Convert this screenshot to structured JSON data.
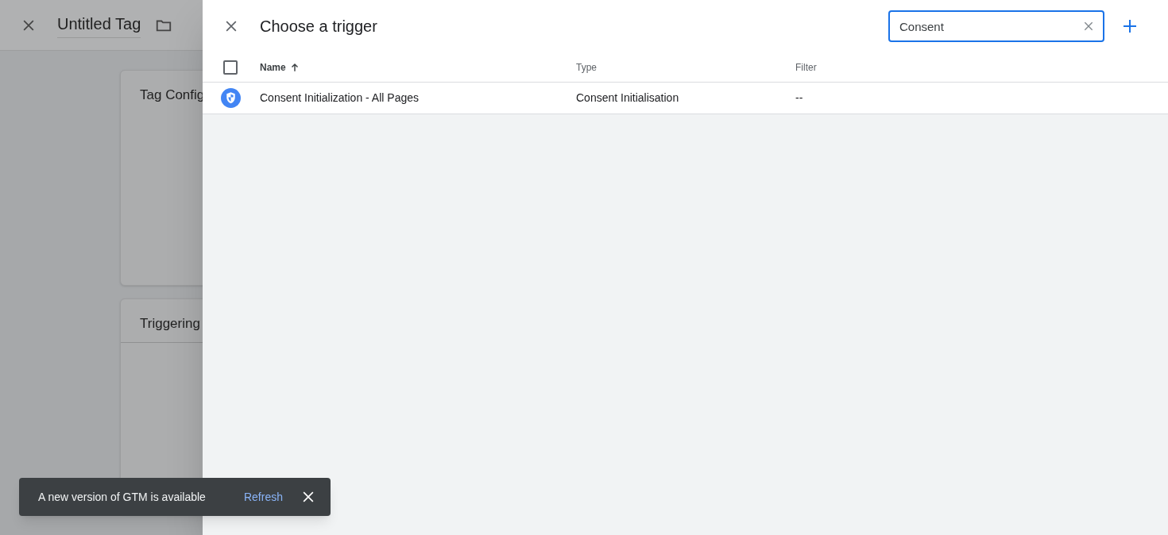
{
  "background_page": {
    "title": "Untitled Tag",
    "cards": [
      {
        "title": "Tag Config"
      },
      {
        "title": "Triggering"
      }
    ]
  },
  "panel": {
    "title": "Choose a trigger",
    "search": {
      "value": "Consent"
    },
    "table": {
      "columns": [
        {
          "label": "Name",
          "sorted": true
        },
        {
          "label": "Type",
          "sorted": false
        },
        {
          "label": "Filter",
          "sorted": false
        }
      ],
      "select_all": {
        "checked": false
      },
      "rows": [
        {
          "name": "Consent Initialization - All Pages",
          "type": "Consent Initialisation",
          "filter": "--"
        }
      ]
    }
  },
  "snackbar": {
    "message": "A new version of GTM is available",
    "action": "Refresh"
  }
}
